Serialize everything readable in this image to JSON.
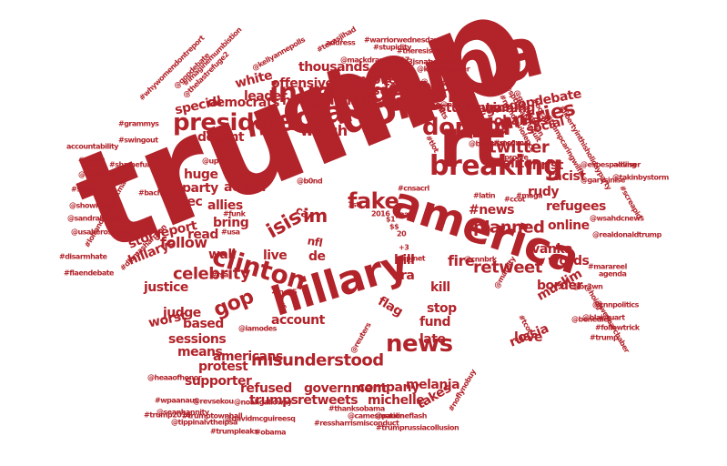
{
  "colors": {
    "word": "#b2232a",
    "background": "#ffffff"
  },
  "words": [
    "trump",
    "obama",
    "rt",
    "america",
    "hillary",
    "investigation",
    "dont",
    "media",
    "breaking",
    "president",
    "clinton",
    "news",
    "donald",
    "countries",
    "fake",
    "gop",
    "isis",
    "im",
    "celebrity",
    "misunderstood",
    "planned",
    "retweet",
    "twitter",
    "watch",
    "follow",
    "fire",
    "democrats",
    "thousands",
    "offensive",
    "proved",
    "foundation",
    "students",
    "winning",
    "social",
    "obamas",
    "leader",
    "claims",
    "hedge",
    "white",
    "special",
    "jesus",
    "#vegasgopdebate",
    "doesnt",
    "huge",
    "action",
    "party",
    "exec",
    "report",
    "story",
    "hillarys",
    "read",
    "wall",
    "live",
    "bring",
    "allies",
    "car",
    "#news",
    "elite",
    "christ",
    "racist",
    "rudy",
    "refugees",
    "online",
    "words",
    "ivanka",
    "border",
    "muslim",
    "bill",
    "era",
    "kill",
    "stop",
    "fund",
    "late",
    "flag",
    "justice",
    "judge",
    "based",
    "worst",
    "sessions",
    "means",
    "account",
    "americans",
    "protest",
    "supporter",
    "refused",
    "government",
    "trumps",
    "retweets",
    "company",
    "melania",
    "michelle",
    "takes",
    "russia",
    "love",
    "de",
    "nfl",
    "accountability",
    "#resist",
    "@vamboa",
    "#salsa",
    "@showkinng",
    "@sandralsegel",
    "@usaherosalute",
    "#disarmhate",
    "#flaendebate",
    "#bachata",
    "#lolrandomchristmas",
    "#trumpcaringwilfie",
    "#libertyinthisholidayparty",
    "@espespalding",
    "@garysinise",
    "adviser",
    "@takinbystorm",
    "#screapid",
    "@wsahdcnews",
    "@realdonaldtrump",
    "#marareel",
    "agenda",
    "@cnnpolitics",
    "@blaistuart",
    "#followtrick",
    "#trump",
    "#grammys",
    "#swingout",
    "#shameful",
    "#whywomendontreport",
    "#imaginemumbistion",
    "@thelastrefuge2",
    "@kellyannepolls",
    "#warriorwednesday",
    "#texasjihad",
    "address",
    "#stupidity",
    "#theresistance",
    "@mackdrama1017",
    "#d3jsnaturenews",
    "@kayemenner",
    "#potus",
    "@nypost",
    "#nomoreviolence",
    "@sharpoints",
    "#mcgwv",
    "@spthelanthesuit",
    "@gaynorsloan",
    "#bozzie",
    "@heaaofhonor",
    "#wpaanaus",
    "@seanhannity",
    "#trump2016",
    "@noahgalloway",
    "#trumptownhall",
    "@revsekou",
    "@davidmcguireesq",
    "#obama",
    "@tippinalvtheipsa",
    "#trumpleaks",
    "#ressharrismisconduct",
    "#trumprussiacollusion",
    "#thanksobama",
    "@camesmation",
    "@paulineflash",
    "#noflynobuy",
    "@reuters",
    "@marelty",
    "@br3wn",
    "@hoidij",
    "@wesbarchaber",
    "@gopdebate",
    "#dlamasharpton",
    "@benedict",
    "#tcot",
    "#maga",
    "#latin",
    "#funk",
    "#usa",
    "#rsa",
    "#potus",
    "@upi",
    "@b0nd",
    "1st",
    "2016",
    "$1",
    "132",
    "$$",
    "20",
    "+3",
    "#pjnet",
    "#cnsacrl",
    "@cnnbrk",
    "#tlot",
    "@brettbaier",
    "#nov5",
    "@iamodes",
    "#ccot",
    "#prolife"
  ]
}
